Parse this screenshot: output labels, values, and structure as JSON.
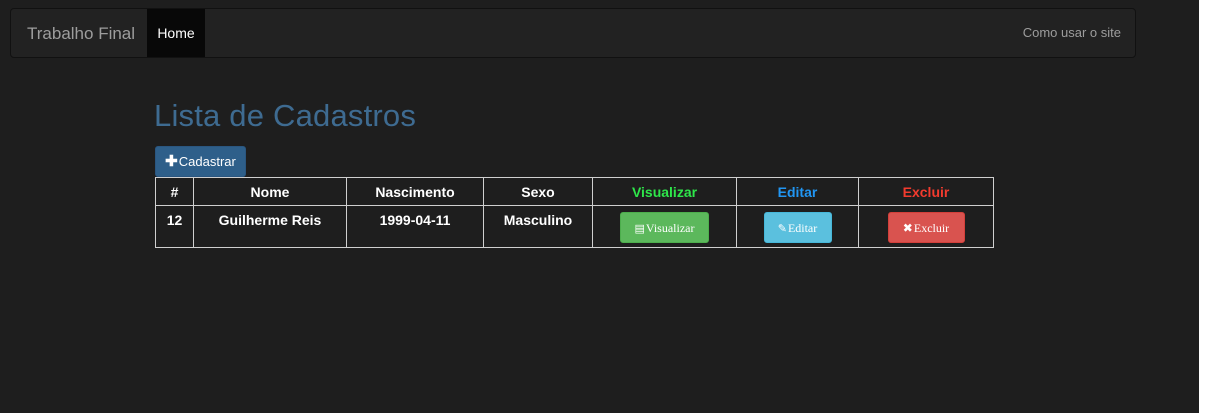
{
  "navbar": {
    "brand": "Trabalho Final",
    "home": "Home",
    "help": "Como usar o site"
  },
  "page": {
    "title": "Lista de Cadastros",
    "register_button": "Cadastrar"
  },
  "table": {
    "headers": {
      "id": "#",
      "name": "Nome",
      "birth": "Nascimento",
      "sex": "Sexo",
      "view": "Visualizar",
      "edit": "Editar",
      "delete": "Excluir"
    },
    "rows": [
      {
        "id": "12",
        "name": "Guilherme Reis",
        "birth": "1999-04-11",
        "sex": "Masculino",
        "view_label": "Visualizar",
        "edit_label": "Editar",
        "delete_label": "Excluir"
      }
    ]
  },
  "icons": {
    "plus": "plus-icon",
    "list": "list-icon",
    "pencil": "pencil-icon",
    "remove": "remove-icon"
  },
  "colors": {
    "background": "#1e1e1e",
    "navbar": "#222222",
    "title": "#3e6b91",
    "view_header": "#2ee64a",
    "edit_header": "#2196f3",
    "delete_header": "#f33b2e",
    "view_button": "#5cb85c",
    "edit_button": "#5bc0de",
    "delete_button": "#d9534f"
  }
}
